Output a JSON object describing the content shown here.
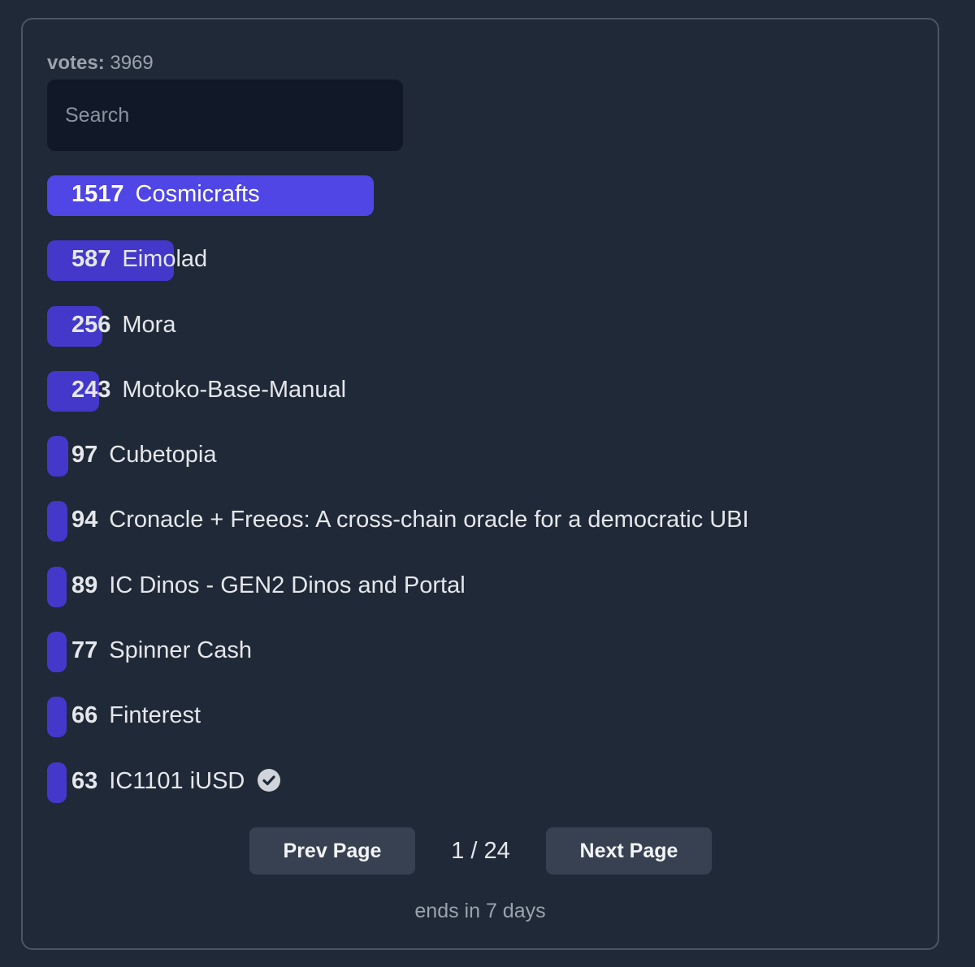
{
  "header": {
    "votes_label": "votes:",
    "votes_total": "3969"
  },
  "search": {
    "placeholder": "Search",
    "value": ""
  },
  "colors": {
    "background": "#1f2937",
    "bar_top": "#4f46e5",
    "bar": "#4338ca",
    "search_bg": "#111827",
    "button_bg": "#374151"
  },
  "list": {
    "max_votes": 1517,
    "items": [
      {
        "count": "1517",
        "name": "Cosmicrafts",
        "votes": 1517,
        "verified": false
      },
      {
        "count": "587",
        "name": "Eimolad",
        "votes": 587,
        "verified": false
      },
      {
        "count": "256",
        "name": "Mora",
        "votes": 256,
        "verified": false
      },
      {
        "count": "243",
        "name": "Motoko-Base-Manual",
        "votes": 243,
        "verified": false
      },
      {
        "count": "97",
        "name": "Cubetopia",
        "votes": 97,
        "verified": false
      },
      {
        "count": "94",
        "name": "Cronacle + Freeos: A cross-chain oracle for a democratic UBI",
        "votes": 94,
        "verified": false
      },
      {
        "count": "89",
        "name": "IC Dinos - GEN2 Dinos and Portal",
        "votes": 89,
        "verified": false
      },
      {
        "count": "77",
        "name": "Spinner Cash",
        "votes": 77,
        "verified": false
      },
      {
        "count": "66",
        "name": "Finterest",
        "votes": 66,
        "verified": false
      },
      {
        "count": "63",
        "name": "IC1101 iUSD",
        "votes": 63,
        "verified": true,
        "badge_icon": "check-circle-icon"
      }
    ]
  },
  "pager": {
    "prev_label": "Prev Page",
    "next_label": "Next Page",
    "indicator": "1 / 24"
  },
  "footer": {
    "ends_text": "ends in 7 days"
  }
}
